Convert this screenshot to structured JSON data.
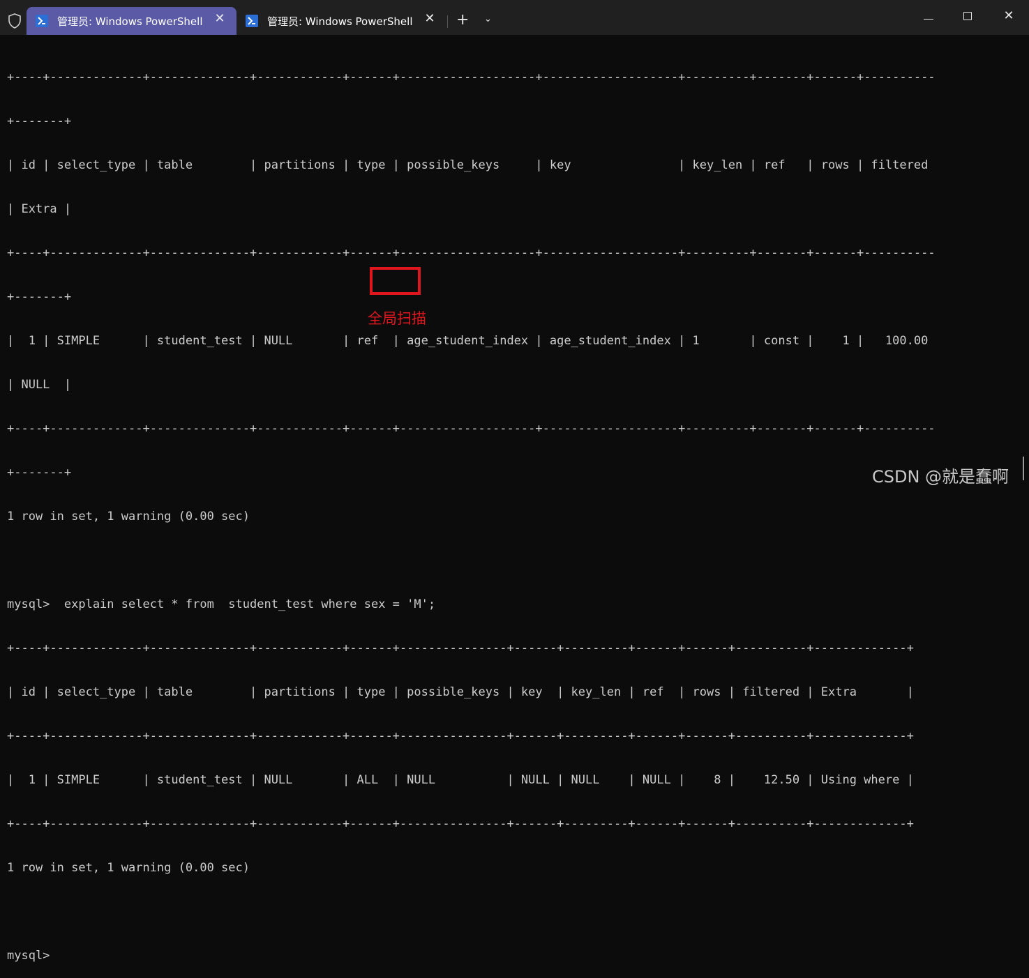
{
  "window": {
    "tabs": [
      {
        "label": "管理员: Windows PowerShell",
        "active": true
      },
      {
        "label": "管理员: Windows PowerShell",
        "active": false
      }
    ],
    "tab_close_glyph": "✕",
    "new_tab_glyph": "+",
    "dropdown_glyph": "⌄",
    "close_glyph": "✕"
  },
  "terminal": {
    "lines": [
      "+----+-------------+--------------+------------+------+-------------------+-------------------+---------+-------+------+----------",
      "+-------+",
      "| id | select_type | table        | partitions | type | possible_keys     | key               | key_len | ref   | rows | filtered",
      "| Extra |",
      "+----+-------------+--------------+------------+------+-------------------+-------------------+---------+-------+------+----------",
      "+-------+",
      "|  1 | SIMPLE      | student_test | NULL       | ref  | age_student_index | age_student_index | 1       | const |    1 |   100.00",
      "| NULL  |",
      "+----+-------------+--------------+------------+------+-------------------+-------------------+---------+-------+------+----------",
      "+-------+",
      "1 row in set, 1 warning (0.00 sec)",
      "",
      "mysql>  explain select * from  student_test where sex = 'M';",
      "+----+-------------+--------------+------------+------+---------------+------+---------+------+------+----------+-------------+",
      "| id | select_type | table        | partitions | type | possible_keys | key  | key_len | ref  | rows | filtered | Extra       |",
      "+----+-------------+--------------+------------+------+---------------+------+---------+------+------+----------+-------------+",
      "|  1 | SIMPLE      | student_test | NULL       | ALL  | NULL          | NULL | NULL    | NULL |    8 |    12.50 | Using where |",
      "+----+-------------+--------------+------------+------+---------------+------+---------+------+------+----------+-------------+",
      "1 row in set, 1 warning (0.00 sec)",
      "",
      "mysql>"
    ]
  },
  "annotation": {
    "text": "全局扫描"
  },
  "watermark": {
    "text": "CSDN @就是蠢啊"
  },
  "colors": {
    "accent_tab": "#5a5aa7",
    "annotation": "#e0161f",
    "terminal_bg": "#0c0c0c"
  }
}
